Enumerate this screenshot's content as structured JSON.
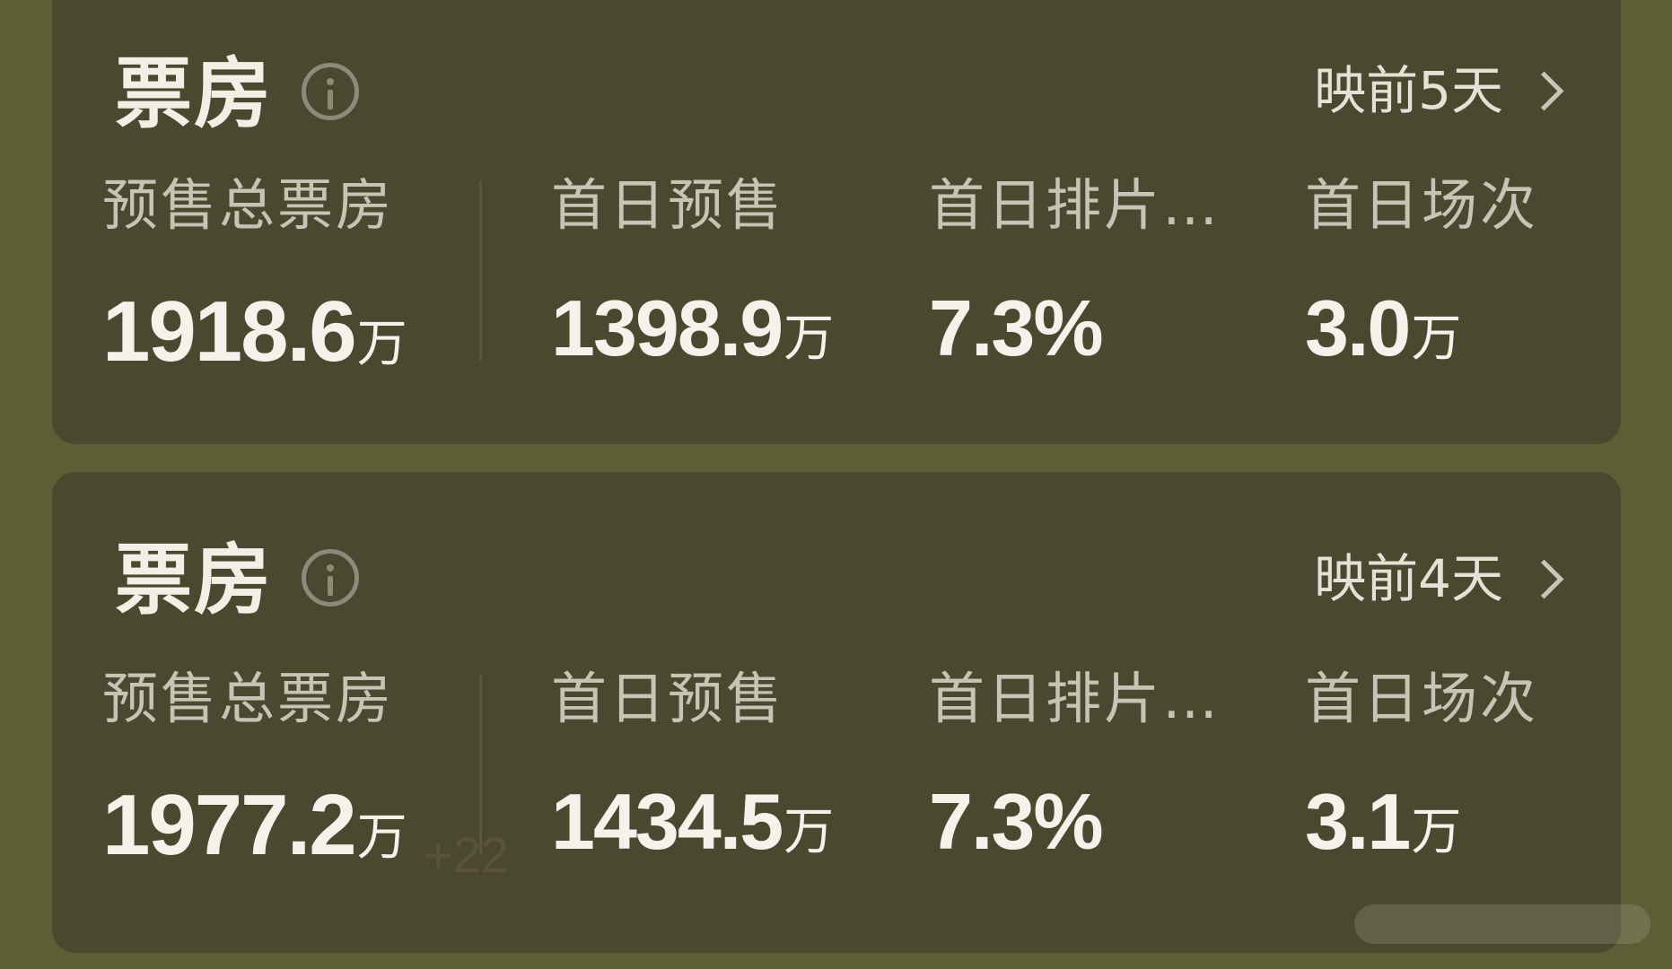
{
  "cards": [
    {
      "title": "票房",
      "period": "映前5天",
      "stats": [
        {
          "label": "预售总票房",
          "value": "1918.6",
          "unit": "万"
        },
        {
          "label": "首日预售",
          "value": "1398.9",
          "unit": "万"
        },
        {
          "label": "首日排片…",
          "value": "7.3%",
          "unit": ""
        },
        {
          "label": "首日场次",
          "value": "3.0",
          "unit": "万"
        }
      ]
    },
    {
      "title": "票房",
      "period": "映前4天",
      "change": "+22",
      "stats": [
        {
          "label": "预售总票房",
          "value": "1977.2",
          "unit": "万"
        },
        {
          "label": "首日预售",
          "value": "1434.5",
          "unit": "万"
        },
        {
          "label": "首日排片…",
          "value": "7.3%",
          "unit": ""
        },
        {
          "label": "首日场次",
          "value": "3.1",
          "unit": "万"
        }
      ]
    }
  ],
  "icons": {
    "info": "info-circle-icon",
    "chevron": "chevron-right-icon"
  },
  "colors": {
    "background": "#5c5f36",
    "card": "#4a4930",
    "text_primary": "#f4f2ea",
    "text_secondary": "#c6c4b4"
  }
}
